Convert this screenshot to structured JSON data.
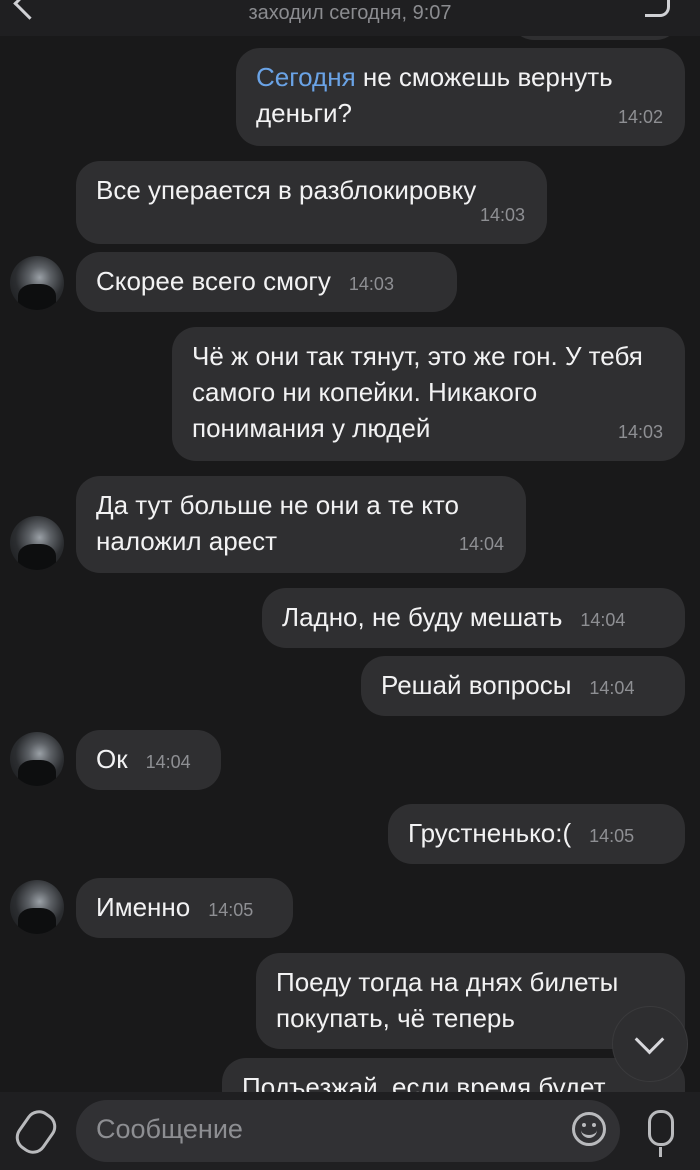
{
  "header": {
    "status": "заходил сегодня, 9:07"
  },
  "messages": [
    {
      "id": 1,
      "side": "out",
      "link_text": "Сегодня",
      "text": " не сможешь вернуть деньги?",
      "time": "14:02"
    },
    {
      "id": 2,
      "side": "in",
      "text": "Все уперается в разблокировку",
      "time": "14:03"
    },
    {
      "id": 3,
      "side": "in",
      "text": "Скорее всего смогу",
      "time": "14:03"
    },
    {
      "id": 4,
      "side": "out",
      "text": "Чё ж они так тянут, это же гон. У тебя самого ни копейки. Никакого понимания у людей",
      "time": "14:03"
    },
    {
      "id": 5,
      "side": "in",
      "text": "Да тут больше не они а те кто наложил арест",
      "time": "14:04"
    },
    {
      "id": 6,
      "side": "out",
      "text": "Ладно, не буду мешать",
      "time": "14:04"
    },
    {
      "id": 7,
      "side": "out",
      "text": "Решай вопросы",
      "time": "14:04"
    },
    {
      "id": 8,
      "side": "in",
      "text": "Ок",
      "time": "14:04"
    },
    {
      "id": 9,
      "side": "out",
      "text": "Грустненько:(",
      "time": "14:05"
    },
    {
      "id": 10,
      "side": "in",
      "text": "Именно",
      "time": "14:05"
    },
    {
      "id": 11,
      "side": "out",
      "text": "Поеду тогда на днях билеты покупать, чё теперь",
      "time": ""
    },
    {
      "id": 12,
      "side": "out",
      "text": "Подъезжай, если время будет",
      "time": ""
    }
  ],
  "composer": {
    "placeholder": "Сообщение"
  },
  "icons": {
    "back": "back-arrow-icon",
    "call": "phone-icon",
    "attach": "paperclip-icon",
    "emoji": "emoji-icon",
    "mic": "microphone-icon",
    "scroll": "chevron-down-icon"
  }
}
